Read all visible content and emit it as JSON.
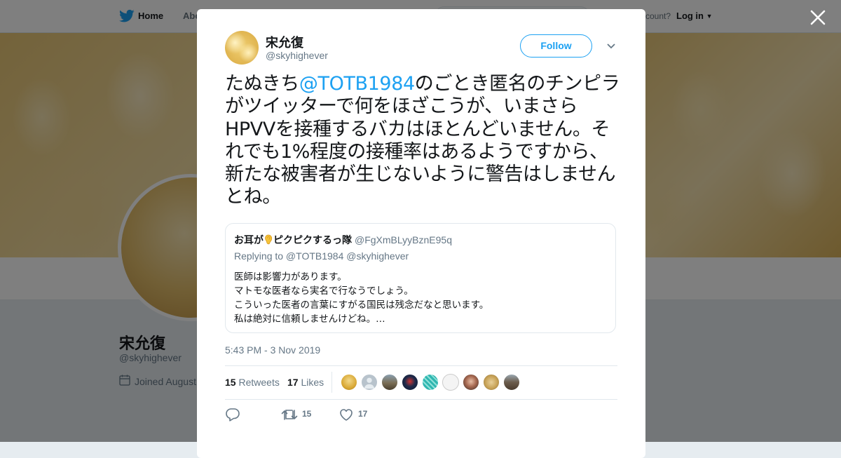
{
  "nav": {
    "home": "Home",
    "about": "Abo",
    "account": "ccount?",
    "login": "Log in"
  },
  "profile": {
    "name": "宋允復",
    "handle": "@skyhighever",
    "joined": "Joined August"
  },
  "tweet": {
    "author_name": "宋允復",
    "author_handle": "@skyhighever",
    "follow_label": "Follow",
    "text_before": "たぬきち",
    "mention": "@TOTB1984",
    "text_after": "のごとき匿名のチンピラがツイッターで何をほざこうが、いまさらHPVVを接種するバカはほとんどいません。それでも1%程度の接種率はあるようですから、新たな被害者が生じないように警告はしませんとね。",
    "timestamp": "5:43 PM - 3 Nov 2019",
    "retweets_count": "15",
    "retweets_label": "Retweets",
    "likes_count": "17",
    "likes_label": "Likes",
    "reply_count": "",
    "retweet_action_count": "15",
    "like_action_count": "17"
  },
  "quote": {
    "name_part1": "お耳が",
    "name_part2": "ピクピクするっ隊",
    "handle": "@FgXmBLyyBznE95q",
    "replying": "Replying to @TOTB1984 @skyhighever",
    "lines": [
      "医師は影響力があります。",
      "マトモな医者なら実名で行なうでしょう。",
      "こういった医者の言葉にすがる国民は残念だなと思います。",
      "私は絶対に信頼しませんけどね。…"
    ]
  },
  "likers": [
    {
      "icon": "blonde-avatar-icon",
      "color": "#d9a936"
    },
    {
      "icon": "default-user-avatar-icon",
      "color": "#b8c3cc"
    },
    {
      "icon": "landscape-avatar-icon",
      "color": "#7a6e55"
    },
    {
      "icon": "dark-avatar-icon",
      "color": "#1e2a4a"
    },
    {
      "icon": "teal-pattern-avatar-icon",
      "color": "#2eb6b0"
    },
    {
      "icon": "sketch-avatar-icon",
      "color": "#f4f4f4"
    },
    {
      "icon": "woman-avatar-icon",
      "color": "#a86a52"
    },
    {
      "icon": "gold-avatar-icon",
      "color": "#c7a257"
    },
    {
      "icon": "rock-avatar-icon",
      "color": "#6b5c4c"
    }
  ],
  "colors": {
    "accent": "#1da1f2",
    "text": "#14171a",
    "secondary": "#657786"
  }
}
